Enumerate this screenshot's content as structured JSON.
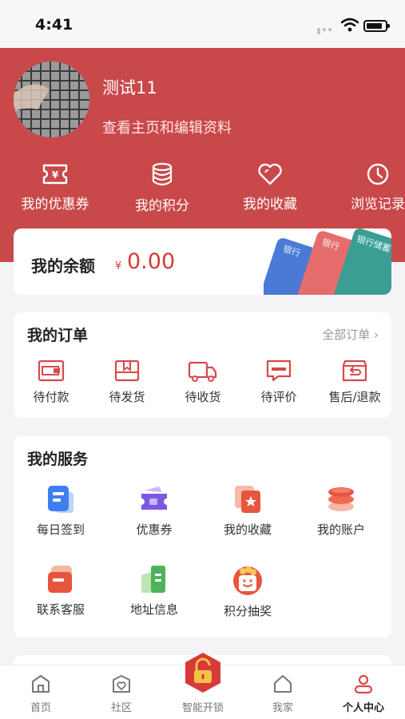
{
  "status_bar": {
    "time": "4:41"
  },
  "profile": {
    "username": "测试11",
    "edit_link": "查看主页和编辑资料"
  },
  "quick_links": [
    {
      "label": "我的优惠券",
      "icon": "coupon-ticket-icon"
    },
    {
      "label": "我的积分",
      "icon": "coins-stack-icon"
    },
    {
      "label": "我的收藏",
      "icon": "heart-icon"
    },
    {
      "label": "浏览记录",
      "icon": "clock-icon"
    }
  ],
  "balance": {
    "title": "我的余额",
    "currency": "¥",
    "amount": "0.00",
    "card_text": "银行",
    "card_text_full": "银行储蓄卡"
  },
  "orders": {
    "title": "我的订单",
    "view_all": "全部订单",
    "items": [
      {
        "label": "待付款",
        "icon": "wallet-icon"
      },
      {
        "label": "待发货",
        "icon": "package-icon"
      },
      {
        "label": "待收货",
        "icon": "truck-icon"
      },
      {
        "label": "待评价",
        "icon": "comment-icon"
      },
      {
        "label": "售后/退款",
        "icon": "refund-box-icon"
      }
    ]
  },
  "services": {
    "title": "我的服务",
    "items": [
      {
        "label": "每日签到",
        "icon": "checkin-icon"
      },
      {
        "label": "优惠券",
        "icon": "coupon-icon"
      },
      {
        "label": "我的收藏",
        "icon": "favorites-star-icon"
      },
      {
        "label": "我的账户",
        "icon": "account-coins-icon"
      },
      {
        "label": "联系客服",
        "icon": "customer-service-icon"
      },
      {
        "label": "地址信息",
        "icon": "address-building-icon"
      },
      {
        "label": "积分抽奖",
        "icon": "points-lottery-icon"
      }
    ]
  },
  "tabbar": {
    "items": [
      {
        "label": "首页",
        "icon": "home-icon"
      },
      {
        "label": "社区",
        "icon": "community-icon"
      },
      {
        "label": "智能开锁",
        "icon": "smart-unlock-icon"
      },
      {
        "label": "我家",
        "icon": "my-home-icon"
      },
      {
        "label": "个人中心",
        "icon": "profile-icon"
      }
    ],
    "active": "个人中心"
  },
  "colors": {
    "brand_red": "#c9484a",
    "price_red": "#d43a3a",
    "page_bg": "#f4f4f6"
  }
}
